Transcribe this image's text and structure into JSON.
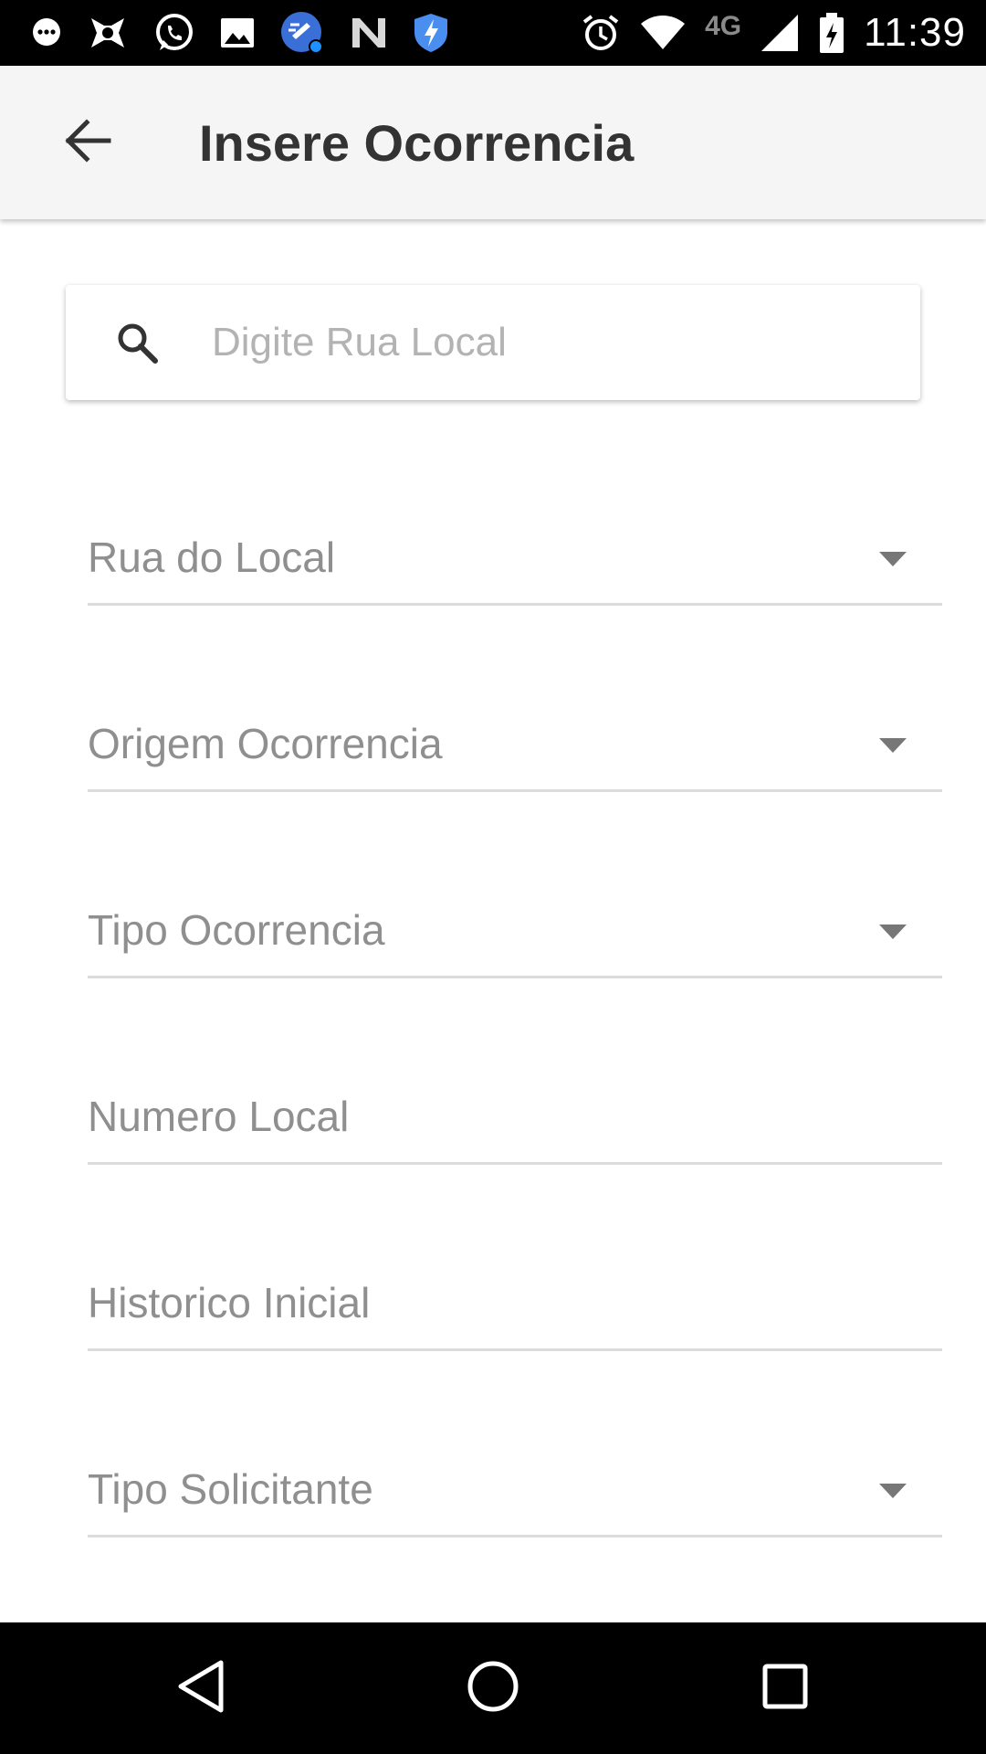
{
  "status_bar": {
    "time": "11:39",
    "network_type": "4G",
    "notification_icons": [
      "chat-bubble-icon",
      "app-icon",
      "whatsapp-icon",
      "gallery-icon",
      "cleaner-icon",
      "n-app-icon",
      "shield-icon"
    ],
    "system_icons": [
      "alarm-icon",
      "wifi-icon",
      "signal-icon",
      "battery-charging-icon"
    ]
  },
  "app_bar": {
    "title": "Insere Ocorrencia",
    "back_icon": "arrow-back-icon"
  },
  "search": {
    "placeholder": "Digite Rua Local",
    "value": "",
    "icon": "search-icon"
  },
  "form": {
    "fields": [
      {
        "label": "Rua do Local",
        "type": "dropdown"
      },
      {
        "label": "Origem Ocorrencia",
        "type": "dropdown"
      },
      {
        "label": "Tipo Ocorrencia",
        "type": "dropdown"
      },
      {
        "label": "Numero Local",
        "type": "text"
      },
      {
        "label": "Historico Inicial",
        "type": "text"
      },
      {
        "label": "Tipo Solicitante",
        "type": "dropdown"
      }
    ]
  },
  "nav_bar": {
    "buttons": [
      "back-triangle-icon",
      "home-circle-icon",
      "recents-square-icon"
    ]
  },
  "colors": {
    "app_bar_bg": "#f5f5f5",
    "title_text": "#333333",
    "label_text": "#8f8f8f",
    "placeholder_text": "#b3b3b3",
    "underline": "#dcdcdc",
    "system_bars": "#000000"
  }
}
